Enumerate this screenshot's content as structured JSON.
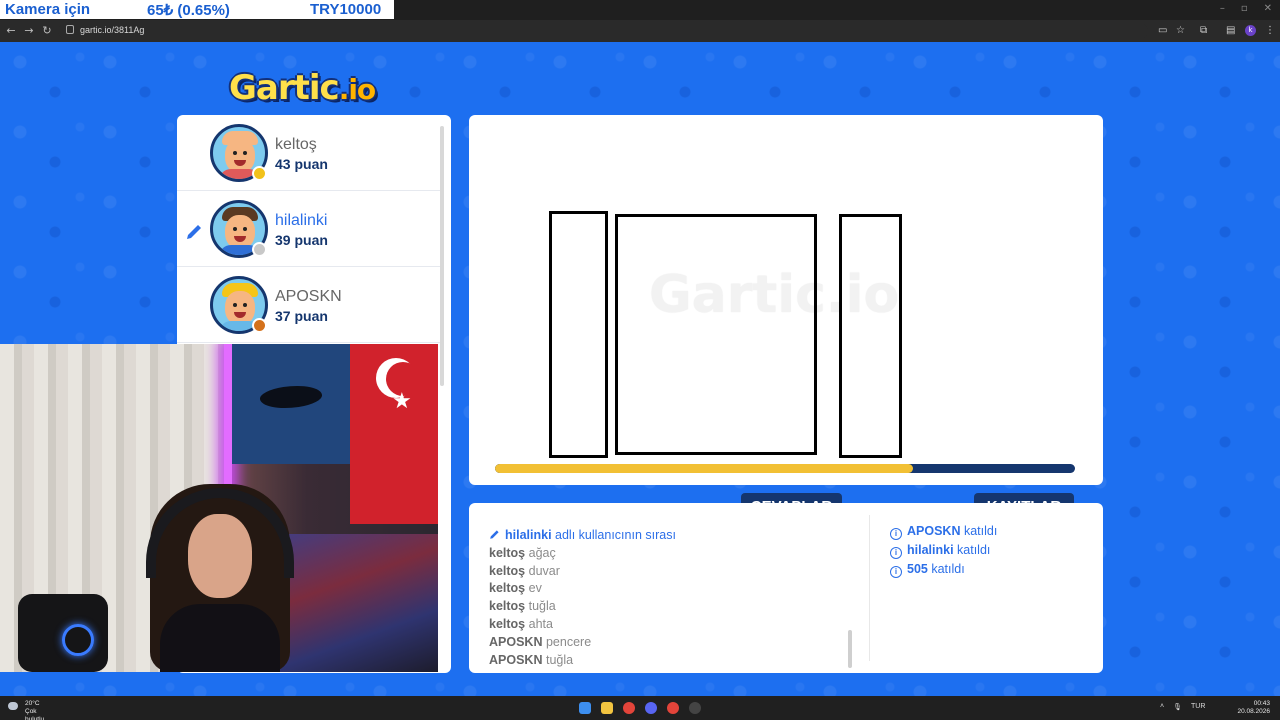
{
  "donation": {
    "label": "Kamera için",
    "amount": "65₺ (0.65%)",
    "goal": "TRY10000"
  },
  "browser": {
    "url": "gartic.io/3811Ag",
    "profile_initial": "k"
  },
  "logo": {
    "main": "Gartic",
    "suffix": ".io"
  },
  "players": [
    {
      "name": "keltoş",
      "score": "43 puan",
      "badge_color": "#f2c21b",
      "hair_color": "#f6b682",
      "body_color": "#e05a5a",
      "drawing": false
    },
    {
      "name": "hilalinki",
      "score": "39 puan",
      "badge_color": "#c8c8c8",
      "hair_color": "#5a3a22",
      "body_color": "#2f6fd6",
      "drawing": true
    },
    {
      "name": "APOSKN",
      "score": "37 puan",
      "badge_color": "#d4711b",
      "hair_color": "#f5c518",
      "body_color": "#67b8e8",
      "drawing": false
    }
  ],
  "canvas": {
    "watermark": "Gartic.io",
    "timer_fraction": 0.72
  },
  "tabs": {
    "answers": "CEVAPLAR",
    "logs": "KAYITLAR"
  },
  "answers": {
    "turn": {
      "user": "hilalinki",
      "text": "adlı kullanıcının sırası"
    },
    "items": [
      {
        "user": "keltoş",
        "word": "ağaç"
      },
      {
        "user": "keltoş",
        "word": "duvar"
      },
      {
        "user": "keltoş",
        "word": "ev"
      },
      {
        "user": "keltoş",
        "word": "tuğla"
      },
      {
        "user": "keltoş",
        "word": "ahta"
      },
      {
        "user": "APOSKN",
        "word": "pencere"
      },
      {
        "user": "APOSKN",
        "word": "tuğla"
      }
    ]
  },
  "logs": [
    {
      "user": "APOSKN",
      "text": "katıldı"
    },
    {
      "user": "hilalinki",
      "text": "katıldı"
    },
    {
      "user": "505",
      "text": "katıldı"
    }
  ],
  "taskbar": {
    "temperature": "20°C",
    "weather": "Çok bulutlu",
    "language": "TUR",
    "time": "00:43",
    "date": "20.08.2026"
  }
}
